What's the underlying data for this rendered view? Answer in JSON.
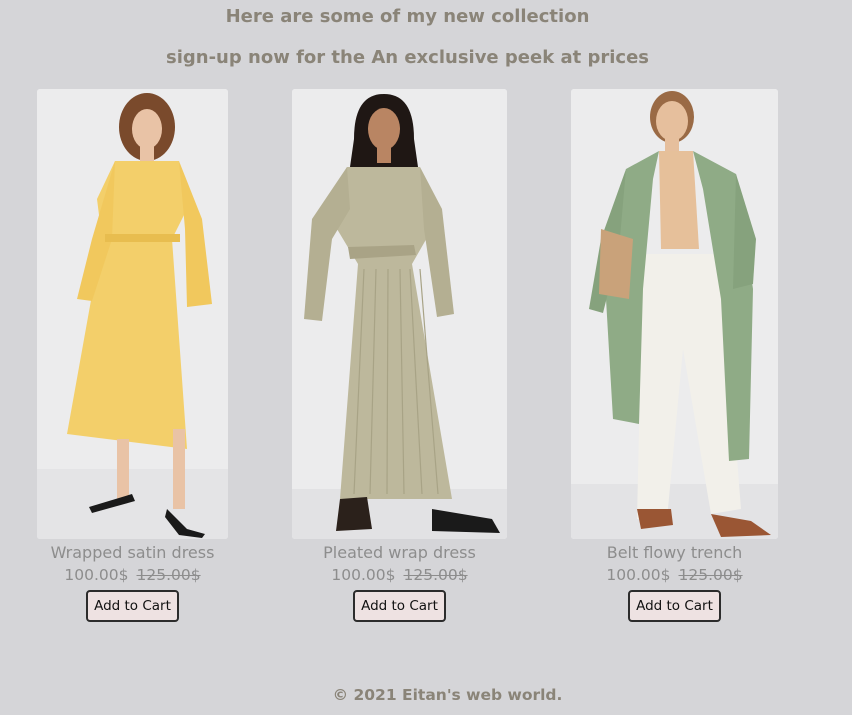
{
  "header": {
    "title": "Here are some of my new collection",
    "subtitle": "sign-up now for the An exclusive peek at prices"
  },
  "products": [
    {
      "name": "Wrapped satin dress",
      "price": "100.00$",
      "old_price": "125.00$",
      "cart_label": "Add to Cart",
      "image_alt": "woman in yellow wrapped satin dress",
      "color": "#f3cf6a"
    },
    {
      "name": "Pleated wrap dress",
      "price": "100.00$",
      "old_price": "125.00$",
      "cart_label": "Add to Cart",
      "image_alt": "woman in sage pleated wrap dress",
      "color": "#bdb89c"
    },
    {
      "name": "Belt flowy trench",
      "price": "100.00$",
      "old_price": "125.00$",
      "cart_label": "Add to Cart",
      "image_alt": "woman in green flowy trench coat and white jeans",
      "color": "#8fab86"
    }
  ],
  "footer": {
    "text": "© 2021 Eitan's web world."
  }
}
